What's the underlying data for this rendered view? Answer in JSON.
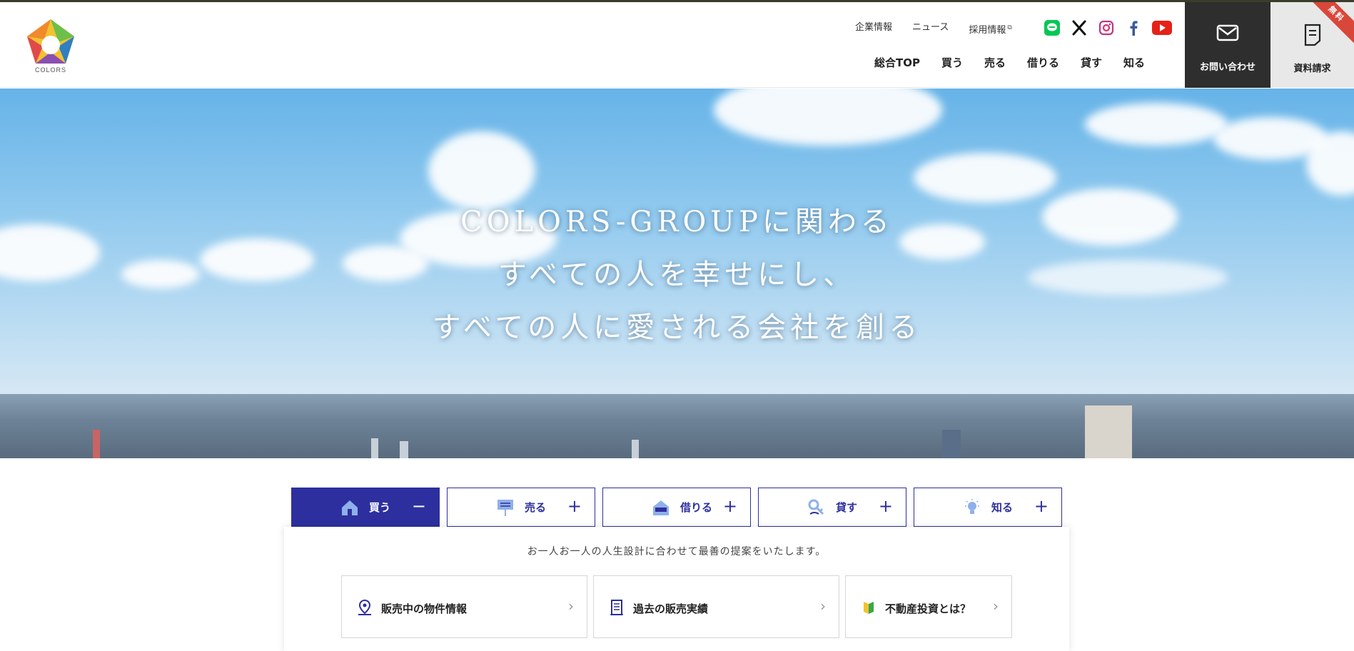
{
  "brand": {
    "logo_text": "COLORS"
  },
  "utility_nav": {
    "company": "企業情報",
    "news": "ニュース",
    "recruit": "採用情報"
  },
  "social": {
    "line": "LINE",
    "x": "X",
    "instagram": "Instagram",
    "facebook": "Facebook",
    "youtube": "YouTube"
  },
  "main_nav": [
    "総合TOP",
    "買う",
    "売る",
    "借りる",
    "貸す",
    "知る"
  ],
  "contact": {
    "label": "お問い合わせ"
  },
  "documents": {
    "label": "資料請求",
    "ribbon": "無料"
  },
  "hero": {
    "line1": "COLORS-GROUPに関わる",
    "line2": "すべての人を幸せにし、",
    "line3": "すべての人に愛される会社を創る"
  },
  "tabs": [
    {
      "label": "買う",
      "icon": "house-icon",
      "sign": "−",
      "active": true
    },
    {
      "label": "売る",
      "icon": "for-sale-sign-icon",
      "sign": "+",
      "active": false
    },
    {
      "label": "借りる",
      "icon": "for-rent-house-icon",
      "sign": "+",
      "active": false
    },
    {
      "label": "貸す",
      "icon": "key-hand-icon",
      "sign": "+",
      "active": false
    },
    {
      "label": "知る",
      "icon": "lightbulb-icon",
      "sign": "+",
      "active": false
    }
  ],
  "panel": {
    "description": "お一人お一人の人生設計に合わせて最善の提案をいたします。",
    "links": [
      {
        "label": "販売中の物件情報",
        "icon": "map-pin-icon"
      },
      {
        "label": "過去の販売実績",
        "icon": "building-icon"
      },
      {
        "label": "不動産投資とは？",
        "icon": "beginner-mark-icon"
      }
    ]
  },
  "colors": {
    "accent": "#2d2f9e",
    "contact_bg": "#2e2e2e",
    "docs_bg": "#e8e8e8",
    "ribbon": "#d9473a"
  }
}
